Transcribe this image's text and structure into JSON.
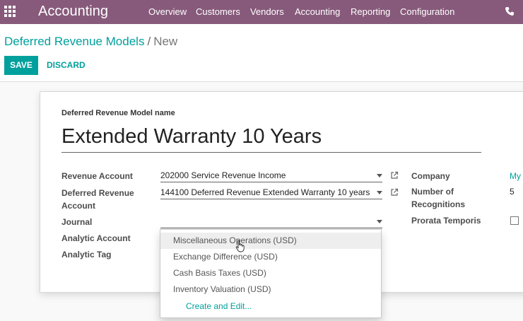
{
  "navbar": {
    "brand": "Accounting",
    "menus": [
      "Overview",
      "Customers",
      "Vendors",
      "Accounting",
      "Reporting",
      "Configuration"
    ],
    "apps_icon": "apps-grid-icon",
    "phone_icon": "phone-icon",
    "bg_color": "#875a7b"
  },
  "breadcrumb": {
    "parent": "Deferred Revenue Models",
    "separator": "/",
    "current": "New"
  },
  "buttons": {
    "save": "SAVE",
    "discard": "DISCARD"
  },
  "form": {
    "name_label": "Deferred Revenue Model name",
    "name_value": "Extended Warranty 10 Years",
    "revenue_account_label": "Revenue Account",
    "revenue_account_value": "202000 Service Revenue Income",
    "deferred_revenue_label_1": "Deferred Revenue",
    "deferred_revenue_label_2": "Account",
    "deferred_revenue_value": "144100 Deferred Revenue Extended Warranty 10 years",
    "journal_label": "Journal",
    "journal_value": "",
    "analytic_account_label": "Analytic Account",
    "analytic_tag_label": "Analytic Tag",
    "company_label": "Company",
    "company_value": "My",
    "recognitions_label_1": "Number of",
    "recognitions_label_2": "Recognitions",
    "recognitions_value": "5",
    "prorata_label": "Prorata Temporis",
    "prorata_checked": false
  },
  "dropdown": {
    "items": [
      "Miscellaneous Operations (USD)",
      "Exchange Difference (USD)",
      "Cash Basis Taxes (USD)",
      "Inventory Valuation (USD)"
    ],
    "create": "Create and Edit..."
  },
  "accent_color": "#00a09d"
}
